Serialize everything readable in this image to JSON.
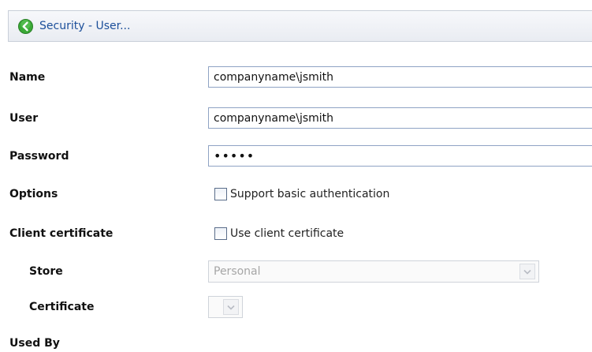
{
  "header": {
    "title": "Security - User...",
    "back_icon": "back-arrow-icon",
    "accent_color": "#3aa936"
  },
  "form": {
    "name": {
      "label": "Name",
      "value": "companyname\\jsmith"
    },
    "user": {
      "label": "User",
      "value": "companyname\\jsmith"
    },
    "password": {
      "label": "Password",
      "value": "•••••"
    },
    "options": {
      "label": "Options",
      "checkbox_label": "Support basic authentication",
      "checked": false
    },
    "client_certificate": {
      "label": "Client certificate",
      "checkbox_label": "Use client certificate",
      "checked": false
    },
    "store": {
      "label": "Store",
      "selected": "Personal",
      "disabled": true
    },
    "certificate": {
      "label": "Certificate",
      "selected": "",
      "disabled": true
    },
    "used_by": {
      "label": "Used By"
    }
  }
}
